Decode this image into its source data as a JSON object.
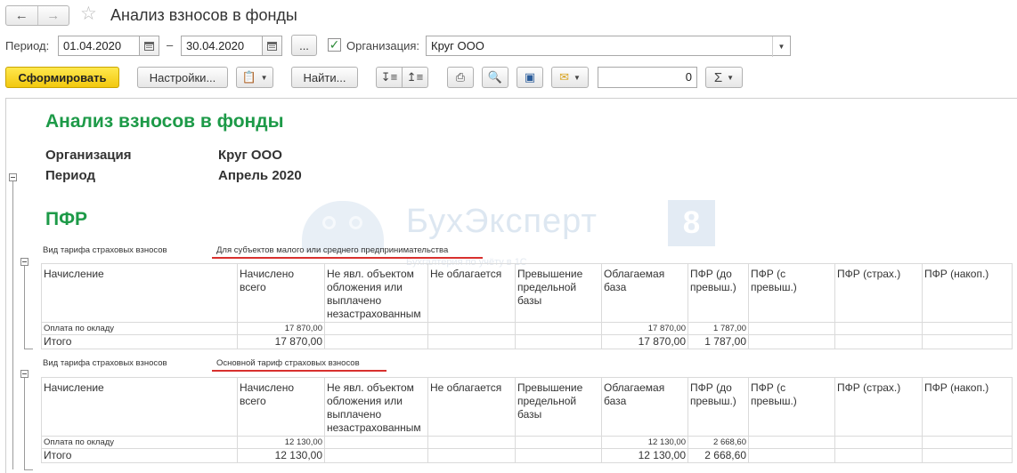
{
  "window": {
    "title": "Анализ взносов в фонды"
  },
  "filters": {
    "period_label": "Период:",
    "date_from": "01.04.2020",
    "date_to": "30.04.2020",
    "dash": "–",
    "more_button": "...",
    "org_checked": true,
    "org_label": "Организация:",
    "org_value": "Круг ООО"
  },
  "toolbar": {
    "generate": "Сформировать",
    "settings": "Настройки...",
    "find": "Найти...",
    "counter_value": "0"
  },
  "report": {
    "title": "Анализ взносов в фонды",
    "org_label": "Организация",
    "org_value": "Круг ООО",
    "period_label": "Период",
    "period_value": "Апрель 2020",
    "section": "ПФР"
  },
  "watermark": {
    "brand": "БухЭксперт",
    "number": "8",
    "sub": "Бухгалтерия по учёту в 1С"
  },
  "tables": [
    {
      "tariff_label": "Вид тарифа страховых взносов",
      "tariff_value": "Для субъектов малого или среднего предпринимательства",
      "columns": [
        "Начисление",
        "Начислено всего",
        "Не явл. объектом обложения или выплачено незастрахованным",
        "Не облагается",
        "Превышение предельной базы",
        "Облагаемая база",
        "ПФР (до превыш.)",
        "ПФР (с превыш.)",
        "ПФР (страх.)",
        "ПФР (накоп.)"
      ],
      "rows": [
        [
          "Оплата по окладу",
          "17 870,00",
          "",
          "",
          "",
          "17 870,00",
          "1 787,00",
          "",
          "",
          ""
        ],
        [
          "Итого",
          "17 870,00",
          "",
          "",
          "",
          "17 870,00",
          "1 787,00",
          "",
          "",
          ""
        ]
      ]
    },
    {
      "tariff_label": "Вид тарифа страховых взносов",
      "tariff_value": "Основной тариф страховых взносов",
      "columns": [
        "Начисление",
        "Начислено всего",
        "Не явл. объектом обложения или выплачено незастрахованным",
        "Не облагается",
        "Превышение предельной базы",
        "Облагаемая база",
        "ПФР (до превыш.)",
        "ПФР (с превыш.)",
        "ПФР (страх.)",
        "ПФР (накоп.)"
      ],
      "rows": [
        [
          "Оплата по окладу",
          "12 130,00",
          "",
          "",
          "",
          "12 130,00",
          "2 668,60",
          "",
          "",
          ""
        ],
        [
          "Итого",
          "12 130,00",
          "",
          "",
          "",
          "12 130,00",
          "2 668,60",
          "",
          "",
          ""
        ]
      ]
    }
  ],
  "colors": {
    "accent_green": "#1d9a48",
    "primary_button": "#f2c80f",
    "underline_red": "#d8302e"
  }
}
